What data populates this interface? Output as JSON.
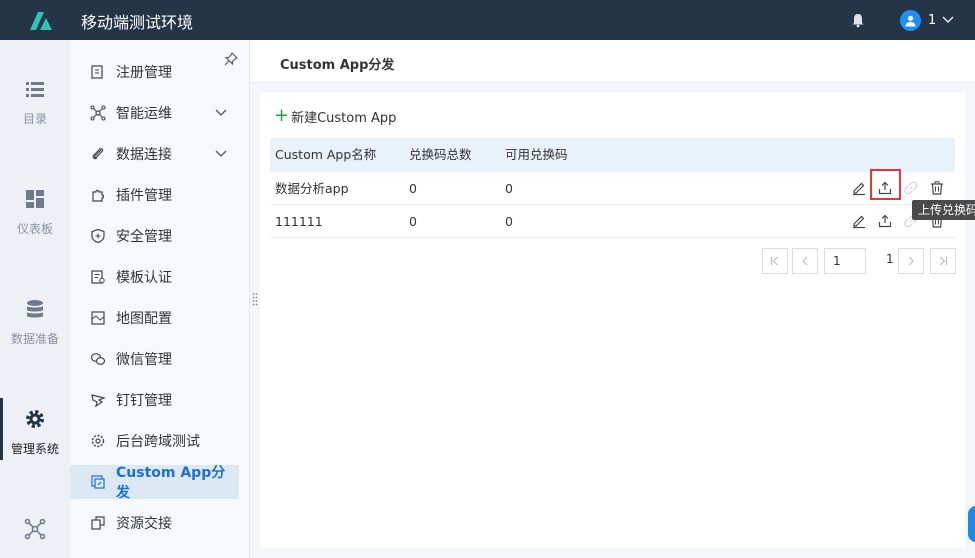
{
  "header": {
    "app_title": "移动端测试环境",
    "user_name": "1"
  },
  "rail": [
    {
      "label": "目录",
      "icon": "list-icon"
    },
    {
      "label": "仪表板",
      "icon": "dashboard-icon"
    },
    {
      "label": "数据准备",
      "icon": "database-icon"
    },
    {
      "label": "管理系统",
      "icon": "gear-icon"
    },
    {
      "label": "",
      "icon": "network-icon"
    }
  ],
  "menu": {
    "items": [
      {
        "label": "注册管理"
      },
      {
        "label": "智能运维"
      },
      {
        "label": "数据连接"
      },
      {
        "label": "插件管理"
      },
      {
        "label": "安全管理"
      },
      {
        "label": "模板认证"
      },
      {
        "label": "地图配置"
      },
      {
        "label": "微信管理"
      },
      {
        "label": "钉钉管理"
      },
      {
        "label": "后台跨域测试"
      },
      {
        "label": "Custom App分发"
      },
      {
        "label": "资源交接"
      }
    ]
  },
  "page": {
    "title": "Custom App分发",
    "new_button": "新建Custom App",
    "columns": [
      "Custom App名称",
      "兑换码总数",
      "可用兑换码"
    ],
    "rows": [
      {
        "name": "数据分析app",
        "total": "0",
        "available": "0"
      },
      {
        "name": "111111",
        "total": "0",
        "available": "0"
      }
    ],
    "tooltip": "上传兑换码",
    "pager": {
      "current": "1",
      "total": "1"
    }
  },
  "colors": {
    "header_bg": "#243548",
    "accent": "#1d6fd1",
    "highlight": "#e53935",
    "add": "#18a058"
  }
}
